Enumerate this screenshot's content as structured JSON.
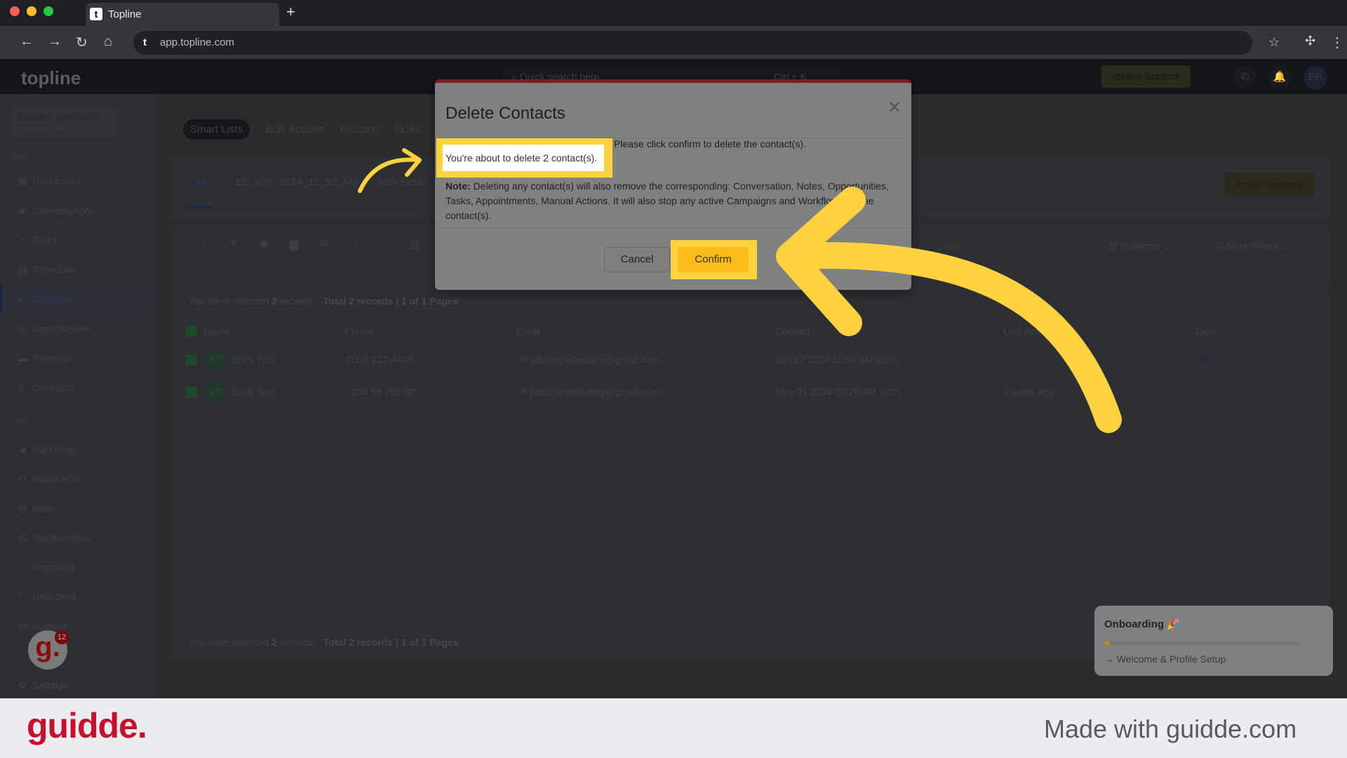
{
  "browser": {
    "tab_title": "Topline",
    "url": "app.topline.com",
    "favicon": "t"
  },
  "header": {
    "logo": "topline",
    "search_placeholder": "Quick search here",
    "search_shortcut": "Ctrl + K",
    "support_label": "topline Support",
    "avatar": "ER"
  },
  "sidebar": {
    "account_name": "Dunder Mifflin [D...",
    "account_location": "Scranton, PA",
    "section_apps": "Apps",
    "apps": [
      {
        "label": "Dashboard",
        "icon": "dashboard-icon"
      },
      {
        "label": "Conversations",
        "icon": "chat-icon"
      },
      {
        "label": "Tasks",
        "icon": "tasks-icon"
      },
      {
        "label": "Scheduler",
        "icon": "calendar-icon"
      },
      {
        "label": "Contacts",
        "icon": "user-icon",
        "active": true
      },
      {
        "label": "Opportunities",
        "icon": "opportunities-icon"
      },
      {
        "label": "Revenue",
        "icon": "revenue-icon"
      },
      {
        "label": "Contracts",
        "icon": "contract-icon"
      }
    ],
    "section_tools": "Tools",
    "tools": [
      {
        "label": "Marketing",
        "icon": "megaphone-icon"
      },
      {
        "label": "Automation",
        "icon": "gears-icon"
      },
      {
        "label": "Sites",
        "icon": "globe-icon"
      },
      {
        "label": "Memberships",
        "icon": "members-icon"
      },
      {
        "label": "Reporting",
        "icon": "pie-chart-icon"
      },
      {
        "label": "Help Desk",
        "icon": "help-icon"
      },
      {
        "label": "Mailfold",
        "icon": "mail-icon"
      }
    ],
    "settings": "Settings",
    "guidde_badge": "12"
  },
  "main": {
    "tabs": [
      "Smart Lists",
      "Bulk Actions",
      "Restore",
      "Tasks"
    ],
    "lists": [
      "All",
      "12_JUN_2024_11_52_AM",
      "With Email"
    ],
    "import_label": "Import Contacts",
    "search_value": "Erick",
    "columns_label": "Columns",
    "more_filters_label": "More Filters",
    "selection_text": "You have selected",
    "selection_count": "2",
    "selection_suffix": "records.",
    "total_text": "Total 2 records | 1 of 1 Pages",
    "columns": [
      "Name",
      "Phone",
      "Email",
      "Created",
      "Last Activity",
      "Tags"
    ],
    "rows": [
      {
        "initials": "ET",
        "name": "Erick Test",
        "phone": "(919) 222-4449",
        "email": "jabronipiebeating@gmail.com",
        "created": "Jun 12 2024 11:56 AM",
        "tz": "(EDT)",
        "last": "",
        "tag": "test"
      },
      {
        "initials": "ET",
        "name": "Erick Test",
        "phone": "+234 56 799 00",
        "email": "jabronipiebeating@gmail.com",
        "created": "May 31 2024 08:26 AM",
        "tz": "(EDT)",
        "last": "1 week ago",
        "tag": ""
      }
    ]
  },
  "modal": {
    "title": "Delete Contacts",
    "lead": "You're about to delete 2 contact(s).",
    "lead2": "Please click confirm to delete the contact(s).",
    "note_label": "Note:",
    "note": "Deleting any contact(s) will also remove the corresponding: Conversation, Notes, Opportunities, Tasks, Appointments, Manual Actions. It will also stop any active Campaigns and Workflows for the contact(s).",
    "cancel": "Cancel",
    "confirm": "Confirm"
  },
  "onboarding": {
    "title": "Onboarding 🎉",
    "progress": 0.03,
    "step": "Welcome & Profile Setup"
  },
  "footer": {
    "logo": "guidde.",
    "made_with": "Made with guidde.com"
  },
  "colors": {
    "highlight": "#fed33f",
    "confirm": "#fbbc17",
    "modal_border": "#7b1e24",
    "brand": "#c8102e"
  }
}
